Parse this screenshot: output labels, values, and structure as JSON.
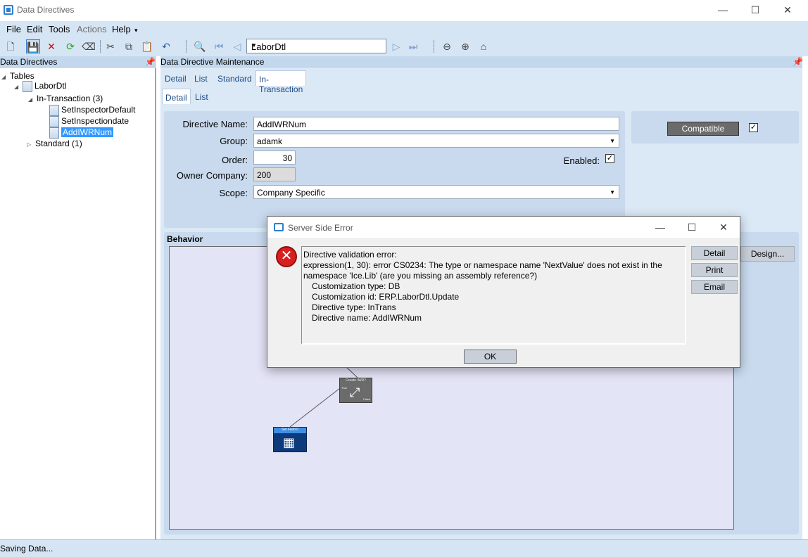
{
  "window": {
    "title": "Data Directives",
    "minimize": "—",
    "maximize": "☐",
    "close": "✕"
  },
  "menu": {
    "items": [
      "File",
      "Edit",
      "Tools",
      "Actions",
      "Help"
    ],
    "more": "▾"
  },
  "toolbar": {
    "record_selector": "LaborDtl"
  },
  "left_pane": {
    "header": "Data Directives",
    "tree": {
      "root": "Tables",
      "table": "LaborDtl",
      "group1": "In-Transaction (3)",
      "items": [
        "SetInspectorDefault",
        "SetInspectiondate",
        "AddIWRNum"
      ],
      "group2": "Standard (1)"
    }
  },
  "right_pane": {
    "header": "Data Directive Maintenance",
    "tabs_top": [
      "Detail",
      "List",
      "Standard",
      "In-Transaction"
    ],
    "tabs_sub": [
      "Detail",
      "List"
    ],
    "form": {
      "directive_name_label": "Directive Name:",
      "directive_name": "AddIWRNum",
      "group_label": "Group:",
      "group": "adamk",
      "order_label": "Order:",
      "order": "30",
      "enabled_label": "Enabled:",
      "owner_company_label": "Owner Company:",
      "owner_company": "200",
      "scope_label": "Scope:",
      "scope": "Company Specific"
    },
    "compatible_button": "Compatible",
    "behavior_label": "Behavior",
    "design_button": "Design...",
    "nodes": {
      "create": "Create IWR?",
      "create_true": "True",
      "create_false": "False",
      "setfield": "Set Field 0"
    }
  },
  "status": {
    "text": "Saving Data..."
  },
  "dialog": {
    "title": "Server Side Error",
    "message": {
      "line1": "Directive validation error:",
      "line2": "expression(1, 30): error CS0234: The type or namespace name 'NextValue' does not exist in the",
      "line3": "namespace 'Ice.Lib' (are you missing an assembly reference?)",
      "line4": "Customization type: DB",
      "line5": "Customization id: ERP.LaborDtl.Update",
      "line6": "Directive type: InTrans",
      "line7": "Directive name: AddIWRNum"
    },
    "buttons": {
      "detail": "Detail",
      "print": "Print",
      "email": "Email",
      "ok": "OK"
    }
  }
}
